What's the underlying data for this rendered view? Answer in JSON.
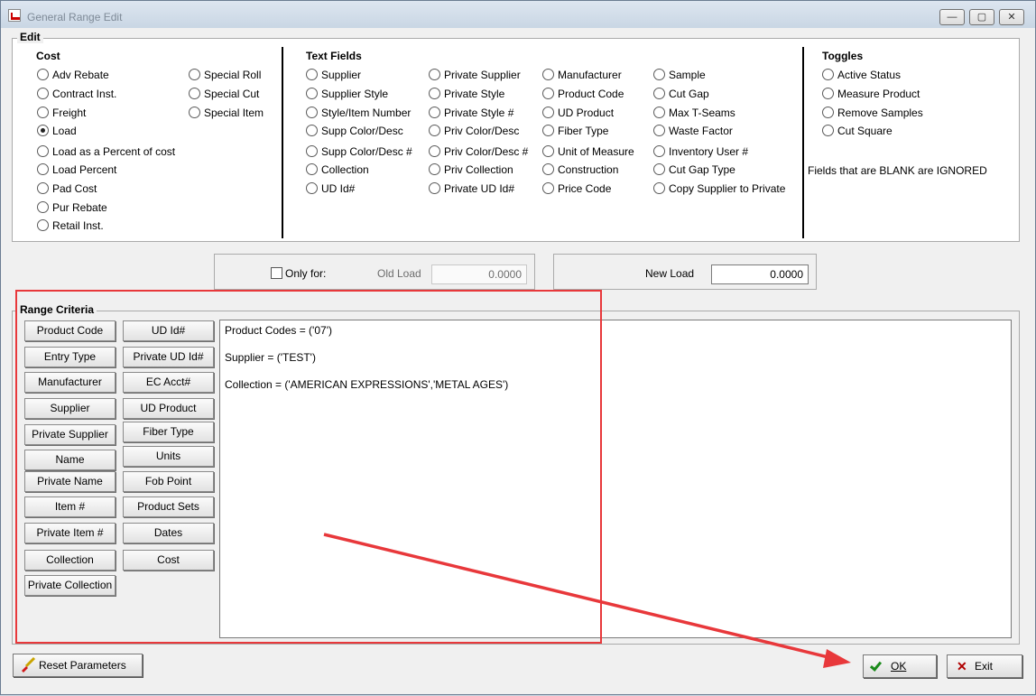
{
  "window": {
    "title": "General Range Edit",
    "caption_buttons": [
      "—",
      "▢",
      "✕"
    ]
  },
  "edit": {
    "group_title": "Edit",
    "cost": {
      "heading": "Cost",
      "col1": [
        "Adv Rebate",
        "Contract Inst.",
        "Freight",
        "Load",
        "Load as a Percent of cost",
        "Load Percent",
        "Pad Cost",
        "Pur Rebate",
        "Retail Inst."
      ],
      "col2": [
        "Special Roll",
        "Special Cut",
        "Special Item"
      ],
      "selected": "Load"
    },
    "text_fields": {
      "heading": "Text Fields",
      "col1": [
        "Supplier",
        "Supplier Style",
        "Style/Item Number",
        "Supp Color/Desc",
        "Supp Color/Desc #",
        "Collection",
        "UD Id#"
      ],
      "col2": [
        "Private Supplier",
        "Private Style",
        "Private Style #",
        "Priv Color/Desc",
        "Priv Color/Desc #",
        "Priv Collection",
        "Private UD Id#"
      ],
      "col3": [
        "Manufacturer",
        "Product Code",
        "UD Product",
        "Fiber Type",
        "Unit of Measure",
        "Construction",
        "Price Code"
      ],
      "col4": [
        "Sample",
        "Cut Gap",
        "Max T-Seams",
        "Waste Factor",
        "Inventory User #",
        "Cut Gap Type",
        "Copy Supplier to Private"
      ]
    },
    "toggles": {
      "heading": "Toggles",
      "items": [
        "Active Status",
        "Measure Product",
        "Remove Samples",
        "Cut Square"
      ],
      "note": "Fields that are BLANK are IGNORED"
    }
  },
  "load": {
    "only_for_label": "Only for:",
    "old_load_label": "Old Load",
    "old_load_value": "0.0000",
    "new_load_label": "New Load",
    "new_load_value": "0.0000"
  },
  "range_criteria": {
    "title": "Range Criteria",
    "buttons_left": [
      "Product Code",
      "Entry Type",
      "Manufacturer",
      "Supplier",
      "Private Supplier",
      "Name",
      "Private Name",
      "Item #",
      "Private Item #",
      "Collection",
      "Private Collection"
    ],
    "buttons_right": [
      "UD Id#",
      "Private UD Id#",
      "EC Acct#",
      "UD Product",
      "Fiber Type",
      "Units",
      "Fob Point",
      "Product Sets",
      "Dates",
      "Cost"
    ],
    "lines": [
      "Product Codes =  ('07')",
      "Supplier  = ('TEST')",
      "Collection  = ('AMERICAN EXPRESSIONS','METAL AGES')"
    ]
  },
  "actions": {
    "reset": "Reset Parameters",
    "ok": "OK",
    "exit": "Exit"
  },
  "colors": {
    "annotation": "#e8383b"
  }
}
